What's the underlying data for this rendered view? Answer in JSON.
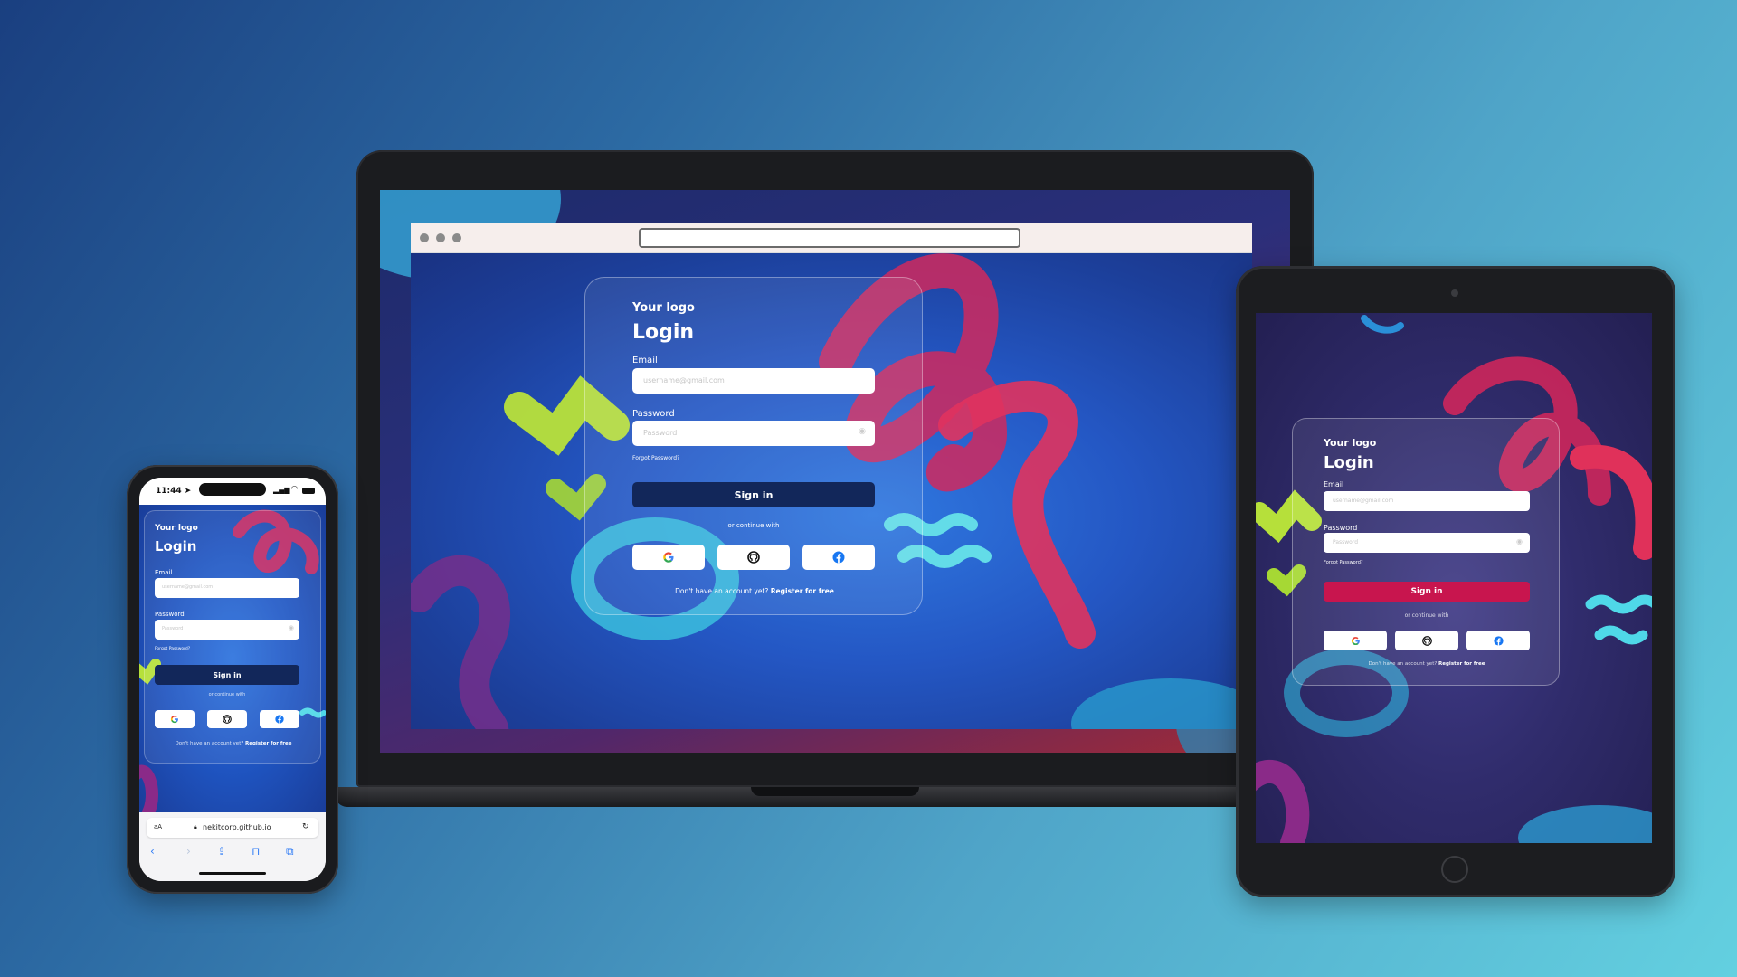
{
  "colors": {
    "accent_navy": "#12275a",
    "accent_crimson": "#c8154e",
    "background_teal": "#5ccbe0"
  },
  "login": {
    "logo": "Your logo",
    "title": "Login",
    "email_label": "Email",
    "email_placeholder": "username@gmail.com",
    "password_label": "Password",
    "password_placeholder": "Password",
    "forgot": "Forgot Password?",
    "sign_in": "Sign in",
    "continue_with": "or continue with",
    "no_account": "Don't have an account yet?",
    "register": "Register for free",
    "social": [
      "google-icon",
      "github-icon",
      "facebook-icon"
    ]
  },
  "phone": {
    "time": "11:44",
    "url_aa": "aA",
    "url": "nekitcorp.github.io"
  }
}
